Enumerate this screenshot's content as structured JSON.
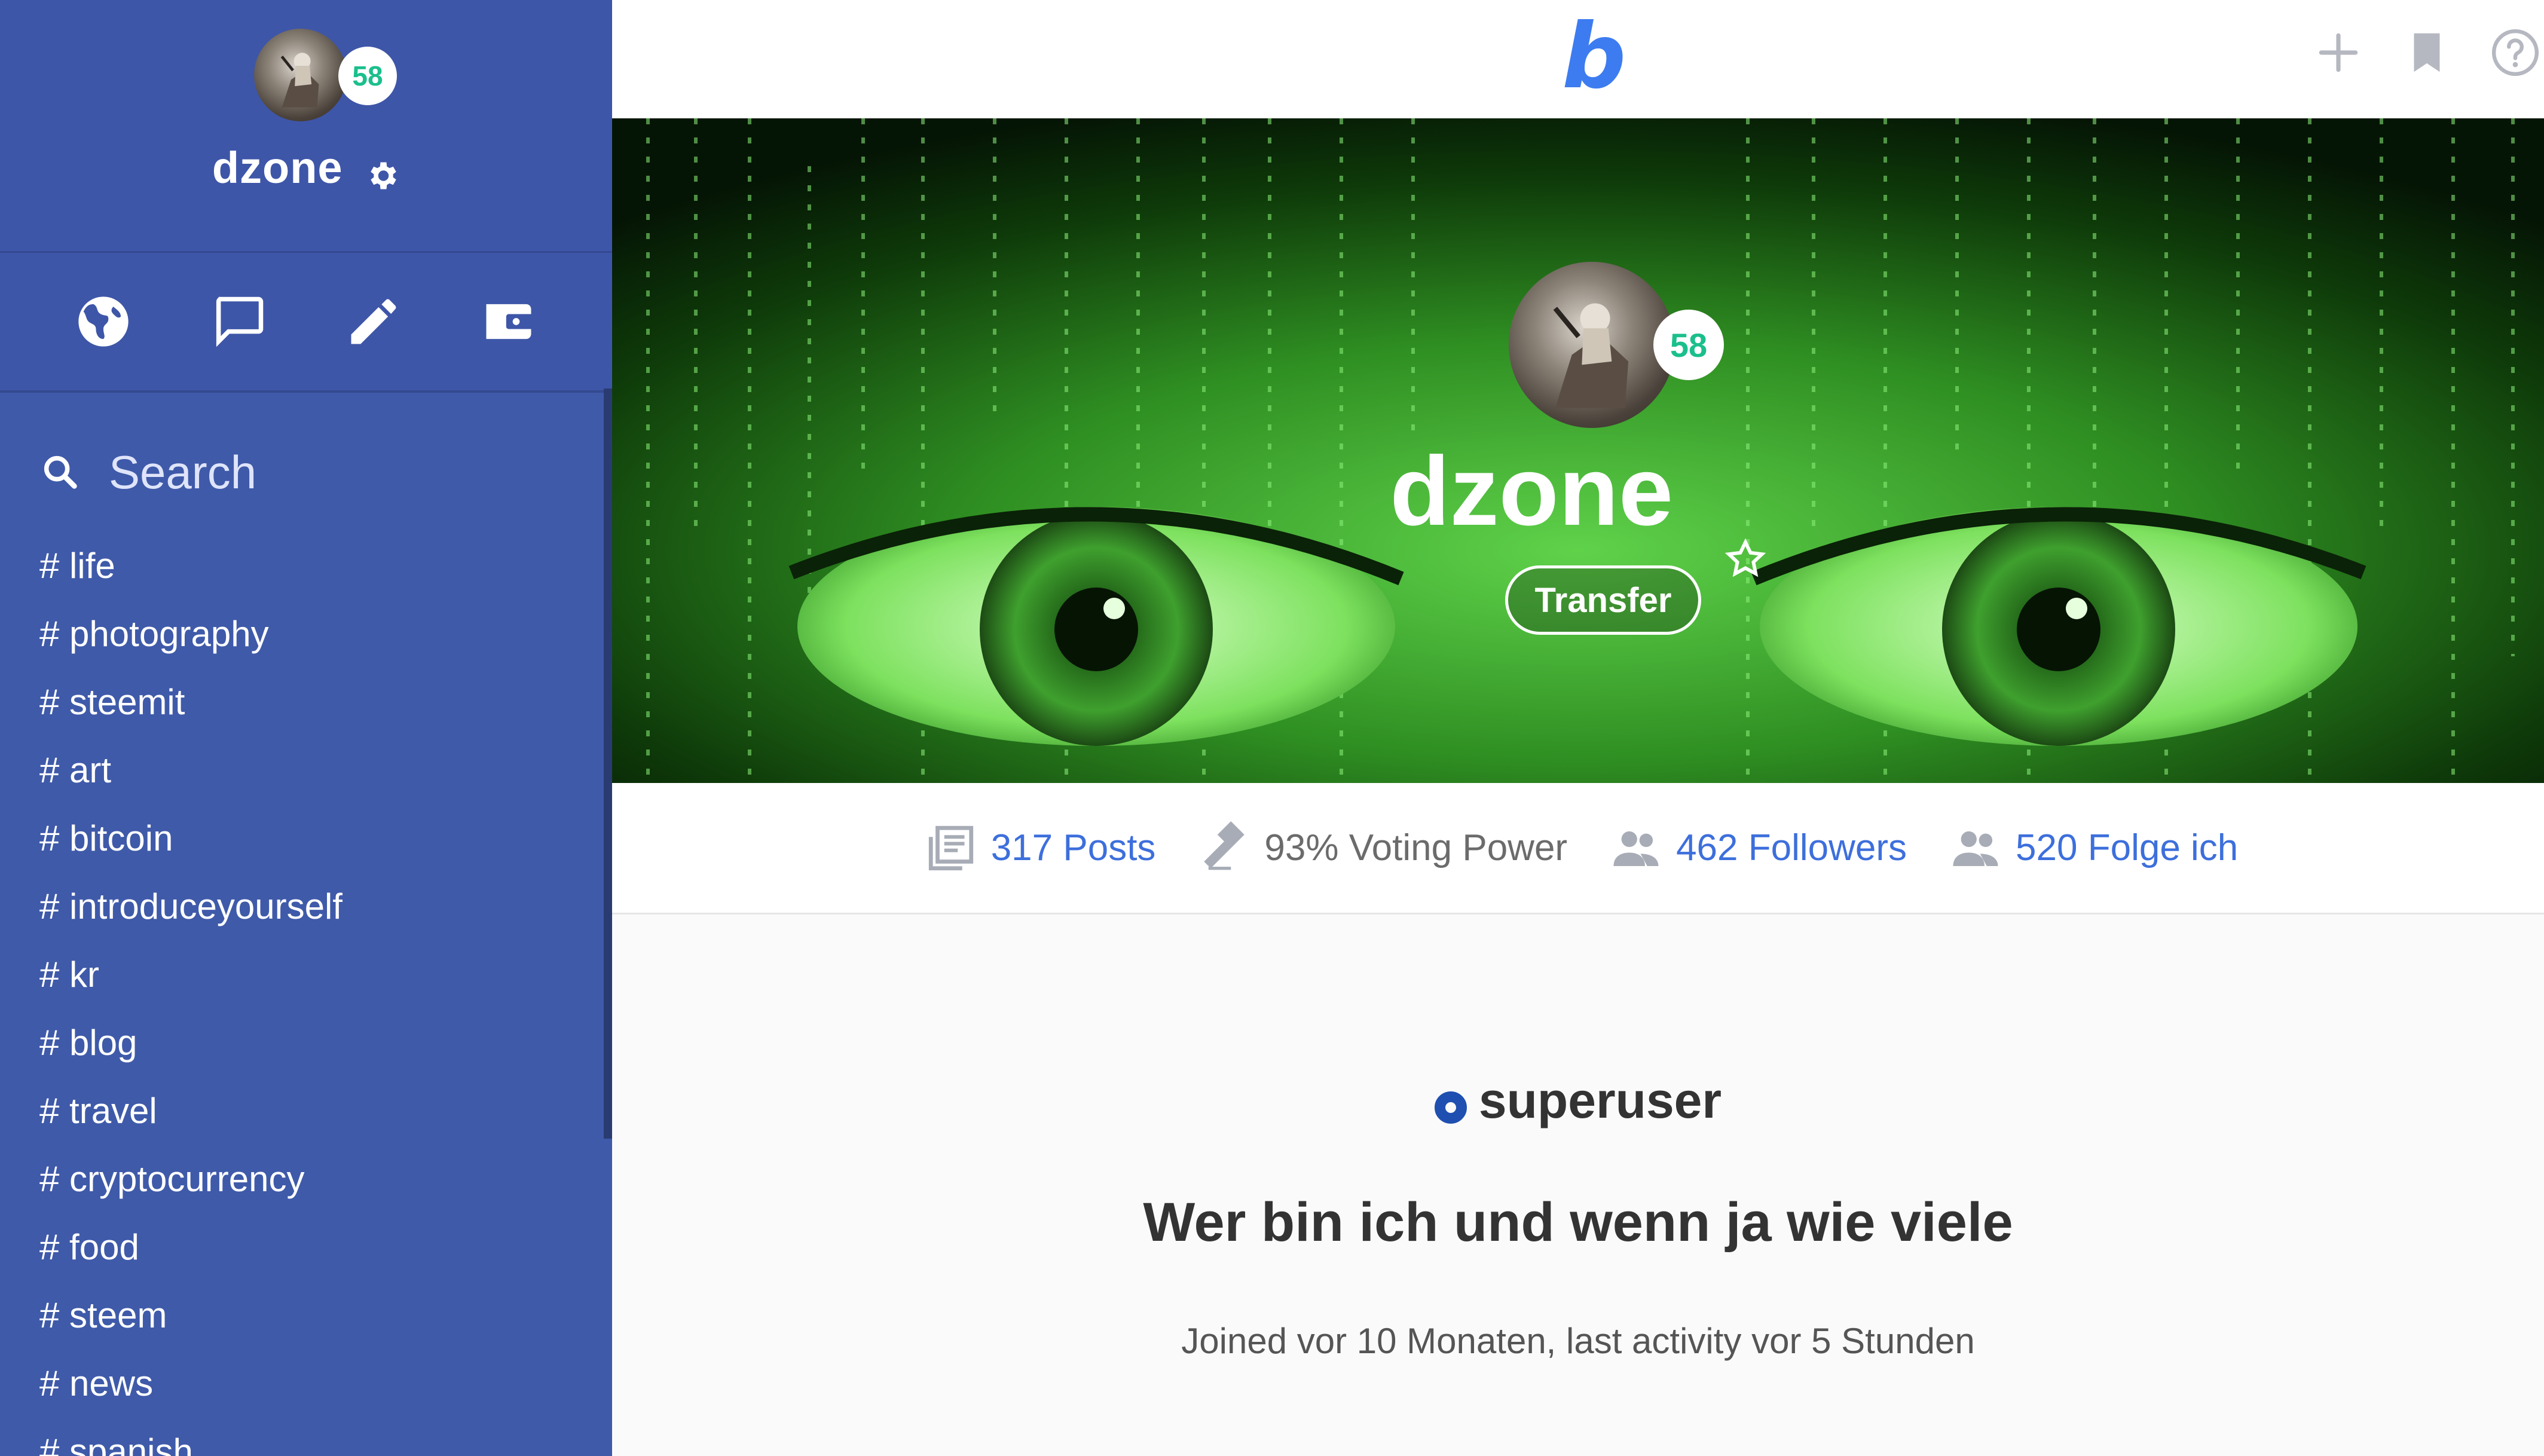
{
  "sidebar": {
    "username": "dzone",
    "reputation": "58",
    "nav_icons": [
      "globe-icon",
      "chat-icon",
      "pencil-icon",
      "wallet-icon"
    ],
    "search_placeholder": "Search",
    "tags": [
      "# life",
      "# photography",
      "# steemit",
      "# art",
      "# bitcoin",
      "# introduceyourself",
      "# kr",
      "# blog",
      "# travel",
      "# cryptocurrency",
      "# food",
      "# steem",
      "# news",
      "# spanish"
    ]
  },
  "topbar": {
    "logo": "b",
    "actions": [
      "plus-icon",
      "bookmark-icon",
      "help-icon"
    ]
  },
  "profile": {
    "name": "dzone",
    "reputation": "58",
    "transfer_label": "Transfer",
    "stats": {
      "posts": "317 Posts",
      "voting_power": "93% Voting Power",
      "followers": "462 Followers",
      "following": "520 Folge ich"
    },
    "role": "superuser",
    "bio": "Wer bin ich und wenn ja wie viele",
    "meta": "Joined vor 10 Monaten, last activity vor 5 Stunden"
  },
  "colors": {
    "sidebar_bg": "#3f5aa9",
    "accent": "#3d7cf0",
    "link": "#3d6fdc",
    "badge_text": "#1bbf8c",
    "role_dot": "#1f4fb0"
  }
}
